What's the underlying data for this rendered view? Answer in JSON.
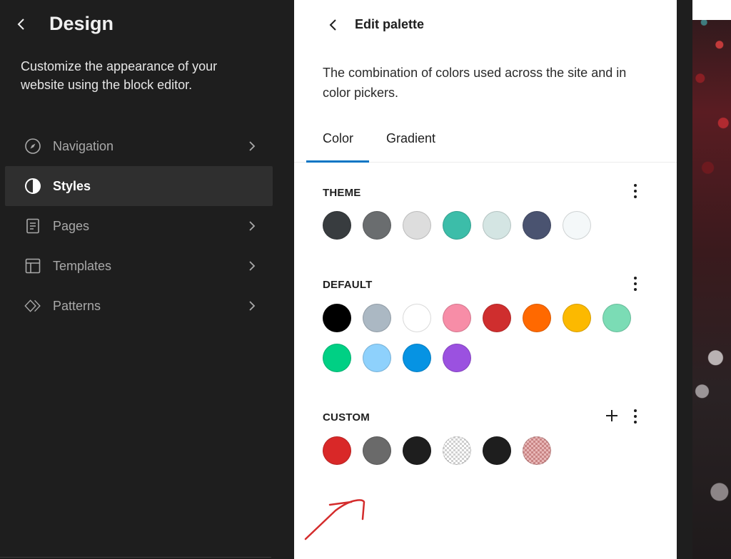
{
  "sidebar": {
    "title": "Design",
    "description": "Customize the appearance of your website using the block editor.",
    "items": [
      {
        "label": "Navigation",
        "icon": "compass-icon",
        "active": false,
        "has_chevron": true
      },
      {
        "label": "Styles",
        "icon": "half-circle-icon",
        "active": true,
        "has_chevron": false
      },
      {
        "label": "Pages",
        "icon": "page-icon",
        "active": false,
        "has_chevron": true
      },
      {
        "label": "Templates",
        "icon": "layout-icon",
        "active": false,
        "has_chevron": true
      },
      {
        "label": "Patterns",
        "icon": "diamond-icon",
        "active": false,
        "has_chevron": true
      }
    ]
  },
  "panel": {
    "title": "Edit palette",
    "description": "The combination of colors used across the site and in color pickers.",
    "tabs": [
      {
        "label": "Color",
        "active": true
      },
      {
        "label": "Gradient",
        "active": false
      }
    ],
    "sections": {
      "theme": {
        "title": "THEME",
        "colors": [
          "#383c3f",
          "#6a6d6f",
          "#dddddd",
          "#3cbda9",
          "#d4e5e3",
          "#4a5370",
          "#f4f8f9"
        ]
      },
      "default": {
        "title": "DEFAULT",
        "colors": [
          "#000000",
          "#abb8c3",
          "#ffffff",
          "#f78da7",
          "#cf2e2e",
          "#ff6900",
          "#fcb900",
          "#7bdcb5",
          "#00d084",
          "#8ed1fc",
          "#0693e3",
          "#9b51e0"
        ]
      },
      "custom": {
        "title": "CUSTOM",
        "colors": [
          "#d92828",
          "#6a6a6a",
          "#1e1e1e",
          "transparent-checker",
          "#1e1e1e",
          "red-checker"
        ]
      }
    }
  },
  "accent_colors": {
    "sidebar_bg": "#1e1e1e",
    "tab_active": "#0675c4",
    "annotation": "#d42c2c"
  }
}
